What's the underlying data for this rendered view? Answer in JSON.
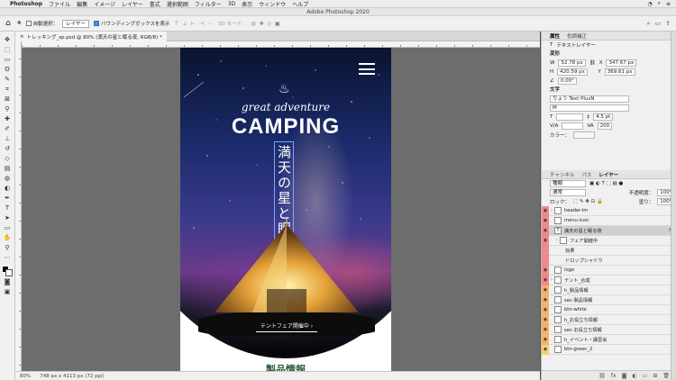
{
  "menubar": {
    "app": "Photoshop",
    "items": [
      "ファイル",
      "編集",
      "イメージ",
      "レイヤー",
      "書式",
      "選択範囲",
      "フィルター",
      "3D",
      "表示",
      "ウィンドウ",
      "ヘルプ"
    ]
  },
  "window_title": "Adobe Photoshop 2020",
  "options": {
    "auto_select_label": "自動選択：",
    "auto_select_value": "レイヤー",
    "transform_label": "バウンディングボックスを表示",
    "mode_3d": "3D モード："
  },
  "document": {
    "tab_label": "トレッキング_sp.psd @ 80% (満天の星と眠る夜, RGB/8) *",
    "zoom": "80%",
    "size": "748 px x 4113 px (72 ppi)"
  },
  "artboard": {
    "script_text": "great adventure",
    "title": "CAMPING",
    "vertical_text": "満天の星と眠る夜",
    "cta": "テントフェア開催中 ›",
    "section_title": "製品情報"
  },
  "properties": {
    "tabs": [
      "属性",
      "色調補正"
    ],
    "layer_kind": "テキストレイヤー",
    "transform_label": "変形",
    "w": "52.78 px",
    "x": "347.67 px",
    "h": "420.59 px",
    "y": "369.61 px",
    "angle": "0.00°",
    "text_label": "文字",
    "font": "りょう Text PlusN",
    "style": "M",
    "size": "4.5 pt",
    "tracking": "200"
  },
  "layers_panel": {
    "tabs": [
      "チャンネル",
      "パス",
      "レイヤー"
    ],
    "kind": "種類",
    "blend": "通常",
    "opacity_label": "不透明度：",
    "opacity": "100%",
    "lock_label": "ロック：",
    "fill_label": "塗り：",
    "fill": "100%",
    "layers": [
      {
        "name": "header-lm",
        "color": "red"
      },
      {
        "name": "menu-icon",
        "color": "red"
      },
      {
        "name": "満天の星と眠る夜",
        "color": "red",
        "selected": true,
        "fx": "fx"
      },
      {
        "name": "フェア開催中",
        "color": "red"
      },
      {
        "name": "効果",
        "color": "red"
      },
      {
        "name": "ドロップシャドウ",
        "color": "red"
      },
      {
        "name": "logo",
        "color": "red"
      },
      {
        "name": "テント_合成",
        "color": "red"
      },
      {
        "name": "h_製品情報",
        "color": "orange"
      },
      {
        "name": "sec-製品情報",
        "color": "orange"
      },
      {
        "name": "btn-white",
        "color": "orange"
      },
      {
        "name": "h_お役立ち情報",
        "color": "orange"
      },
      {
        "name": "sec-お役立ち情報",
        "color": "orange"
      },
      {
        "name": "h_イベント・講習会",
        "color": "orange"
      },
      {
        "name": "btn-green_2",
        "color": "yellow"
      }
    ]
  }
}
